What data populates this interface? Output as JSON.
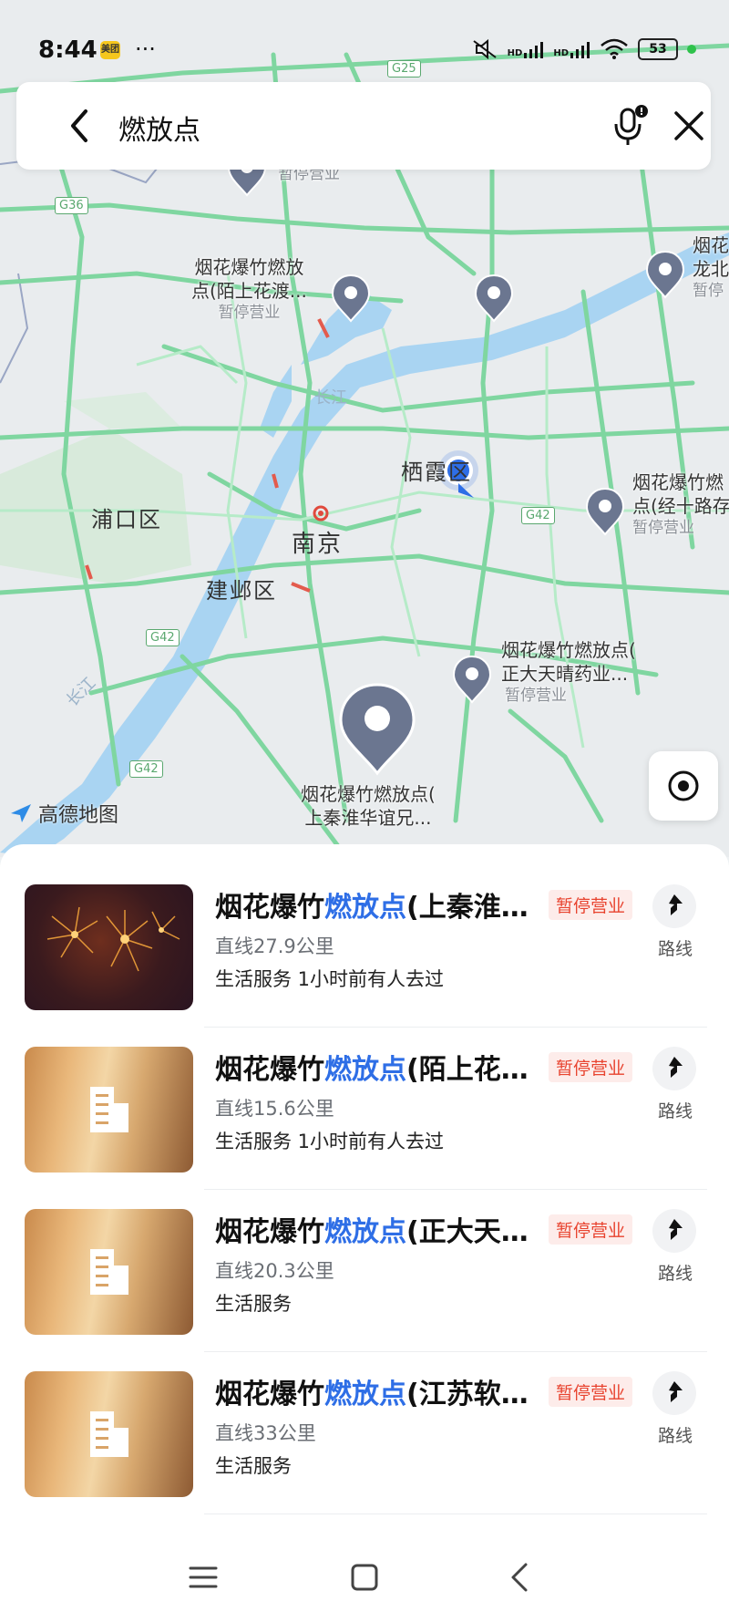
{
  "status_bar": {
    "time": "8:44",
    "app_icon": "美团",
    "more": "···",
    "signal1": "HD",
    "signal2": "HD",
    "battery": "53"
  },
  "search": {
    "query": "燃放点",
    "back_icon": "chevron-left-icon",
    "mic_icon": "microphone-icon",
    "close_icon": "close-icon"
  },
  "map": {
    "labels": {
      "pukou": "浦口区",
      "nanjing": "南京",
      "jianye": "建邺区",
      "qixia": "栖霞区",
      "changjiang_1": "长江",
      "changjiang_2": "长江"
    },
    "highways": [
      "G25",
      "G36",
      "G42",
      "G42",
      "G42"
    ],
    "brand": "高德地图",
    "pois": [
      {
        "name_line1": "",
        "name_line2": "",
        "status": "暂停营业"
      },
      {
        "name_line1": "烟花爆竹燃放",
        "name_line2": "点(陌上花渡...",
        "status": "暂停营业"
      },
      {
        "name_line1": "烟花",
        "name_line2": "龙北",
        "status": "暂停"
      },
      {
        "name_line1": "烟花爆竹燃",
        "name_line2": "点(经十路存",
        "status": "暂停营业"
      },
      {
        "name_line1": "烟花爆竹燃放点(",
        "name_line2": "正大天晴药业...",
        "status": "暂停营业"
      },
      {
        "name_line1": "烟花爆竹燃放点(",
        "name_line2": "上秦淮华谊兄...",
        "status": "暂停营业"
      }
    ]
  },
  "results": [
    {
      "title_prefix": "烟花爆竹",
      "title_highlight": "燃放点",
      "title_suffix": "(上秦淮…",
      "badge": "暂停营业",
      "distance": "直线27.9公里",
      "meta": "生活服务  1小时前有人去过",
      "route_label": "路线",
      "thumb": "fireworks"
    },
    {
      "title_prefix": "烟花爆竹",
      "title_highlight": "燃放点",
      "title_suffix": "(陌上花…",
      "badge": "暂停营业",
      "distance": "直线15.6公里",
      "meta": "生活服务  1小时前有人去过",
      "route_label": "路线",
      "thumb": "building"
    },
    {
      "title_prefix": "烟花爆竹",
      "title_highlight": "燃放点",
      "title_suffix": "(正大天…",
      "badge": "暂停营业",
      "distance": "直线20.3公里",
      "meta": "生活服务",
      "route_label": "路线",
      "thumb": "building"
    },
    {
      "title_prefix": "烟花爆竹",
      "title_highlight": "燃放点",
      "title_suffix": "(江苏软…",
      "badge": "暂停营业",
      "distance": "直线33公里",
      "meta": "生活服务",
      "route_label": "路线",
      "thumb": "building"
    }
  ],
  "colors": {
    "accent": "#2e6ee6",
    "badge_text": "#e8432f",
    "badge_bg": "#fdecea",
    "road": "#7fd6a0",
    "river": "#a9d4f2",
    "pin": "#6b7690"
  }
}
